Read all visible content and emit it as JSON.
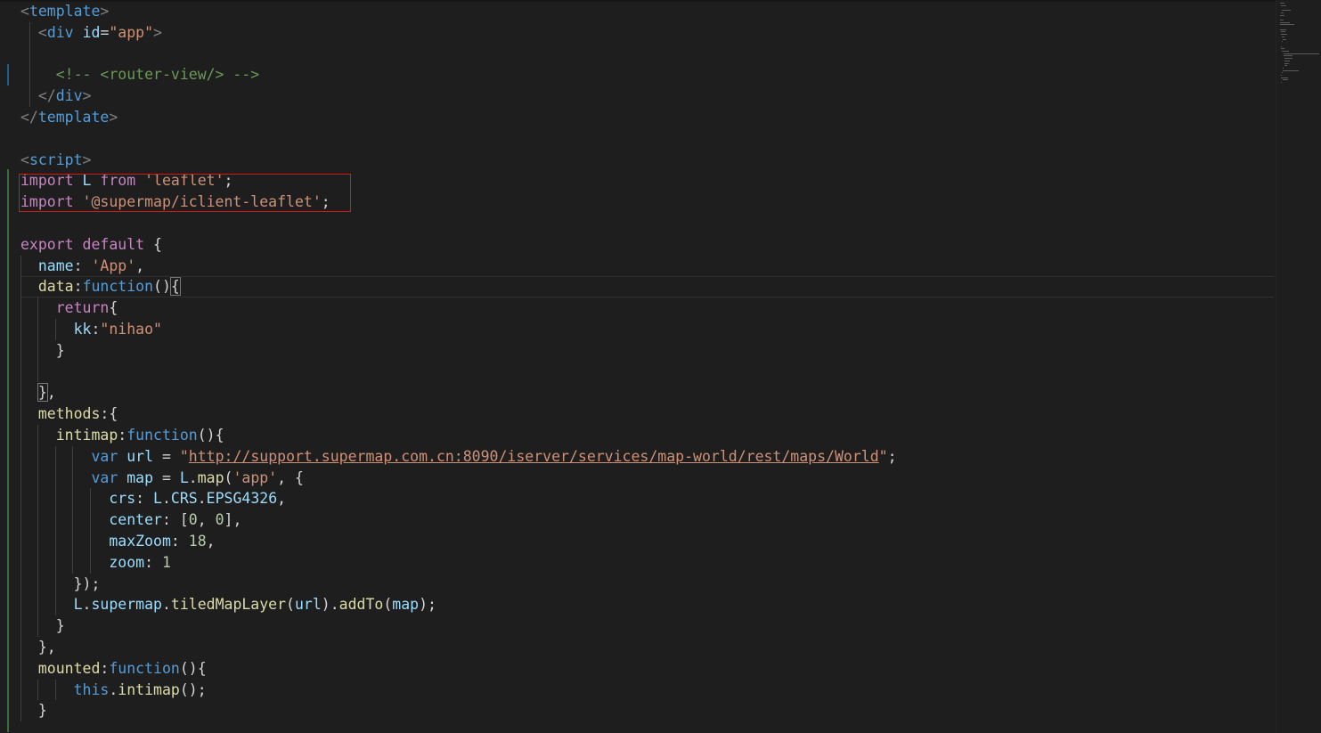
{
  "editor": {
    "language": "vue",
    "highlight_color": "#d11a1a",
    "lines": [
      [
        {
          "c": "t-tag",
          "t": "<"
        },
        {
          "c": "t-tagname",
          "t": "template"
        },
        {
          "c": "t-tag",
          "t": ">"
        }
      ],
      [
        {
          "c": "t-plain",
          "t": "  "
        },
        {
          "c": "t-tag",
          "t": "<"
        },
        {
          "c": "t-tagname",
          "t": "div"
        },
        {
          "c": "t-plain",
          "t": " "
        },
        {
          "c": "t-attr",
          "t": "id"
        },
        {
          "c": "t-plain",
          "t": "="
        },
        {
          "c": "t-str",
          "t": "\"app\""
        },
        {
          "c": "t-tag",
          "t": ">"
        }
      ],
      [],
      [
        {
          "c": "t-plain",
          "t": "    "
        },
        {
          "c": "t-comment",
          "t": "<!-- <router-view/> -->"
        }
      ],
      [
        {
          "c": "t-plain",
          "t": "  "
        },
        {
          "c": "t-tag",
          "t": "</"
        },
        {
          "c": "t-tagname",
          "t": "div"
        },
        {
          "c": "t-tag",
          "t": ">"
        }
      ],
      [
        {
          "c": "t-tag",
          "t": "</"
        },
        {
          "c": "t-tagname",
          "t": "template"
        },
        {
          "c": "t-tag",
          "t": ">"
        }
      ],
      [],
      [
        {
          "c": "t-tag",
          "t": "<"
        },
        {
          "c": "t-tagname",
          "t": "script"
        },
        {
          "c": "t-tag",
          "t": ">"
        }
      ],
      [
        {
          "c": "t-kw",
          "t": "import"
        },
        {
          "c": "t-plain",
          "t": " "
        },
        {
          "c": "t-var",
          "t": "L"
        },
        {
          "c": "t-plain",
          "t": " "
        },
        {
          "c": "t-kw",
          "t": "from"
        },
        {
          "c": "t-plain",
          "t": " "
        },
        {
          "c": "t-str",
          "t": "'leaflet'"
        },
        {
          "c": "t-plain",
          "t": ";"
        }
      ],
      [
        {
          "c": "t-kw",
          "t": "import"
        },
        {
          "c": "t-plain",
          "t": " "
        },
        {
          "c": "t-str",
          "t": "'@supermap/iclient-leaflet'"
        },
        {
          "c": "t-plain",
          "t": ";"
        }
      ],
      [],
      [
        {
          "c": "t-kw",
          "t": "export"
        },
        {
          "c": "t-plain",
          "t": " "
        },
        {
          "c": "t-kw",
          "t": "default"
        },
        {
          "c": "t-plain",
          "t": " {"
        }
      ],
      [
        {
          "c": "t-plain",
          "t": "  "
        },
        {
          "c": "t-var",
          "t": "name"
        },
        {
          "c": "t-plain",
          "t": ": "
        },
        {
          "c": "t-str",
          "t": "'App'"
        },
        {
          "c": "t-plain",
          "t": ","
        }
      ],
      [
        {
          "c": "t-plain",
          "t": "  "
        },
        {
          "c": "t-fn",
          "t": "data"
        },
        {
          "c": "t-plain",
          "t": ":"
        },
        {
          "c": "t-blue",
          "t": "function"
        },
        {
          "c": "t-plain",
          "t": "()"
        },
        {
          "c": "t-bracket",
          "t": "{"
        }
      ],
      [
        {
          "c": "t-plain",
          "t": "    "
        },
        {
          "c": "t-kw",
          "t": "return"
        },
        {
          "c": "t-plain",
          "t": "{"
        }
      ],
      [
        {
          "c": "t-plain",
          "t": "      "
        },
        {
          "c": "t-var",
          "t": "kk"
        },
        {
          "c": "t-plain",
          "t": ":"
        },
        {
          "c": "t-str",
          "t": "\"nihao\""
        }
      ],
      [
        {
          "c": "t-plain",
          "t": "    }"
        }
      ],
      [],
      [
        {
          "c": "t-plain",
          "t": "  "
        },
        {
          "c": "t-bracket",
          "t": "}"
        },
        {
          "c": "t-plain",
          "t": ","
        }
      ],
      [
        {
          "c": "t-plain",
          "t": "  "
        },
        {
          "c": "t-fn",
          "t": "methods"
        },
        {
          "c": "t-plain",
          "t": ":{"
        }
      ],
      [
        {
          "c": "t-plain",
          "t": "    "
        },
        {
          "c": "t-fn",
          "t": "intimap"
        },
        {
          "c": "t-plain",
          "t": ":"
        },
        {
          "c": "t-blue",
          "t": "function"
        },
        {
          "c": "t-plain",
          "t": "(){"
        }
      ],
      [
        {
          "c": "t-plain",
          "t": "        "
        },
        {
          "c": "t-blue",
          "t": "var"
        },
        {
          "c": "t-plain",
          "t": " "
        },
        {
          "c": "t-var",
          "t": "url"
        },
        {
          "c": "t-plain",
          "t": " = "
        },
        {
          "c": "t-str",
          "t": "\""
        },
        {
          "c": "t-url",
          "t": "http://support.supermap.com.cn:8090/iserver/services/map-world/rest/maps/World"
        },
        {
          "c": "t-str",
          "t": "\""
        },
        {
          "c": "t-plain",
          "t": ";"
        }
      ],
      [
        {
          "c": "t-plain",
          "t": "        "
        },
        {
          "c": "t-blue",
          "t": "var"
        },
        {
          "c": "t-plain",
          "t": " "
        },
        {
          "c": "t-var",
          "t": "map"
        },
        {
          "c": "t-plain",
          "t": " = "
        },
        {
          "c": "t-var",
          "t": "L"
        },
        {
          "c": "t-plain",
          "t": "."
        },
        {
          "c": "t-fn",
          "t": "map"
        },
        {
          "c": "t-plain",
          "t": "("
        },
        {
          "c": "t-str",
          "t": "'app'"
        },
        {
          "c": "t-plain",
          "t": ", {"
        }
      ],
      [
        {
          "c": "t-plain",
          "t": "          "
        },
        {
          "c": "t-var",
          "t": "crs"
        },
        {
          "c": "t-plain",
          "t": ": "
        },
        {
          "c": "t-var",
          "t": "L"
        },
        {
          "c": "t-plain",
          "t": "."
        },
        {
          "c": "t-var",
          "t": "CRS"
        },
        {
          "c": "t-plain",
          "t": "."
        },
        {
          "c": "t-var",
          "t": "EPSG4326"
        },
        {
          "c": "t-plain",
          "t": ","
        }
      ],
      [
        {
          "c": "t-plain",
          "t": "          "
        },
        {
          "c": "t-var",
          "t": "center"
        },
        {
          "c": "t-plain",
          "t": ": ["
        },
        {
          "c": "t-num",
          "t": "0"
        },
        {
          "c": "t-plain",
          "t": ", "
        },
        {
          "c": "t-num",
          "t": "0"
        },
        {
          "c": "t-plain",
          "t": "],"
        }
      ],
      [
        {
          "c": "t-plain",
          "t": "          "
        },
        {
          "c": "t-var",
          "t": "maxZoom"
        },
        {
          "c": "t-plain",
          "t": ": "
        },
        {
          "c": "t-num",
          "t": "18"
        },
        {
          "c": "t-plain",
          "t": ","
        }
      ],
      [
        {
          "c": "t-plain",
          "t": "          "
        },
        {
          "c": "t-var",
          "t": "zoom"
        },
        {
          "c": "t-plain",
          "t": ": "
        },
        {
          "c": "t-num",
          "t": "1"
        }
      ],
      [
        {
          "c": "t-plain",
          "t": "      });"
        }
      ],
      [
        {
          "c": "t-plain",
          "t": "      "
        },
        {
          "c": "t-var",
          "t": "L"
        },
        {
          "c": "t-plain",
          "t": "."
        },
        {
          "c": "t-var",
          "t": "supermap"
        },
        {
          "c": "t-plain",
          "t": "."
        },
        {
          "c": "t-fn",
          "t": "tiledMapLayer"
        },
        {
          "c": "t-plain",
          "t": "("
        },
        {
          "c": "t-var",
          "t": "url"
        },
        {
          "c": "t-plain",
          "t": ")."
        },
        {
          "c": "t-fn",
          "t": "addTo"
        },
        {
          "c": "t-plain",
          "t": "("
        },
        {
          "c": "t-var",
          "t": "map"
        },
        {
          "c": "t-plain",
          "t": ");"
        }
      ],
      [
        {
          "c": "t-plain",
          "t": "    }"
        }
      ],
      [
        {
          "c": "t-plain",
          "t": "  },"
        }
      ],
      [
        {
          "c": "t-plain",
          "t": "  "
        },
        {
          "c": "t-fn",
          "t": "mounted"
        },
        {
          "c": "t-plain",
          "t": ":"
        },
        {
          "c": "t-blue",
          "t": "function"
        },
        {
          "c": "t-plain",
          "t": "(){"
        }
      ],
      [
        {
          "c": "t-plain",
          "t": "      "
        },
        {
          "c": "t-blue",
          "t": "this"
        },
        {
          "c": "t-plain",
          "t": "."
        },
        {
          "c": "t-fn",
          "t": "intimap"
        },
        {
          "c": "t-plain",
          "t": "();"
        }
      ],
      [
        {
          "c": "t-plain",
          "t": "  }"
        }
      ]
    ]
  }
}
